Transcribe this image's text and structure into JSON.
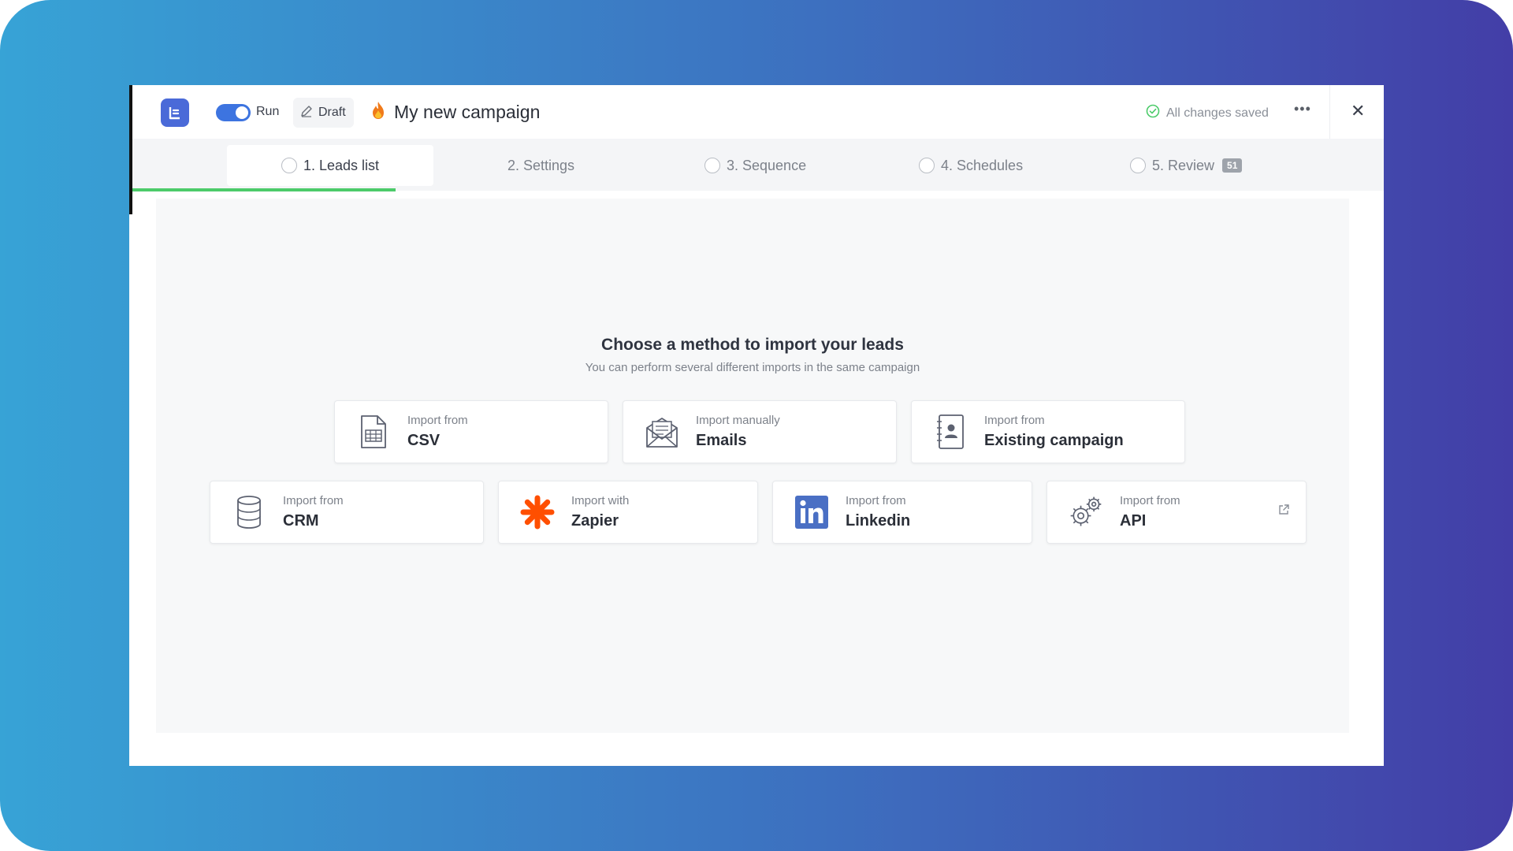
{
  "header": {
    "run_label": "Run",
    "draft_label": "Draft",
    "campaign_title": "My new campaign",
    "saved_status": "All changes saved",
    "more_label": "•••",
    "close_label": "✕"
  },
  "steps": [
    {
      "label": "1.  Leads list",
      "active": true
    },
    {
      "label": "2.  Settings",
      "active": false
    },
    {
      "label": "3.  Sequence",
      "active": false
    },
    {
      "label": "4.  Schedules",
      "active": false
    },
    {
      "label": "5.  Review",
      "active": false,
      "badge": "51"
    }
  ],
  "main": {
    "heading": "Choose a method to import your leads",
    "subheading": "You can perform several different imports in the same campaign",
    "methods": [
      {
        "sub": "Import from",
        "main": "CSV",
        "icon": "csv-file-icon"
      },
      {
        "sub": "Import manually",
        "main": "Emails",
        "icon": "envelope-icon"
      },
      {
        "sub": "Import from",
        "main": "Existing campaign",
        "icon": "contact-book-icon"
      },
      {
        "sub": "Import from",
        "main": "CRM",
        "icon": "database-icon"
      },
      {
        "sub": "Import with",
        "main": "Zapier",
        "icon": "zapier-icon"
      },
      {
        "sub": "Import from",
        "main": "Linkedin",
        "icon": "linkedin-icon"
      },
      {
        "sub": "Import from",
        "main": "API",
        "icon": "gears-icon"
      }
    ]
  },
  "colors": {
    "brand": "#4a6ad8",
    "toggle_on": "#3d74e0",
    "progress": "#4ccb6a",
    "zapier": "#ff4f00",
    "linkedin": "#4a6fc4",
    "saved_check": "#4ccb6a"
  }
}
